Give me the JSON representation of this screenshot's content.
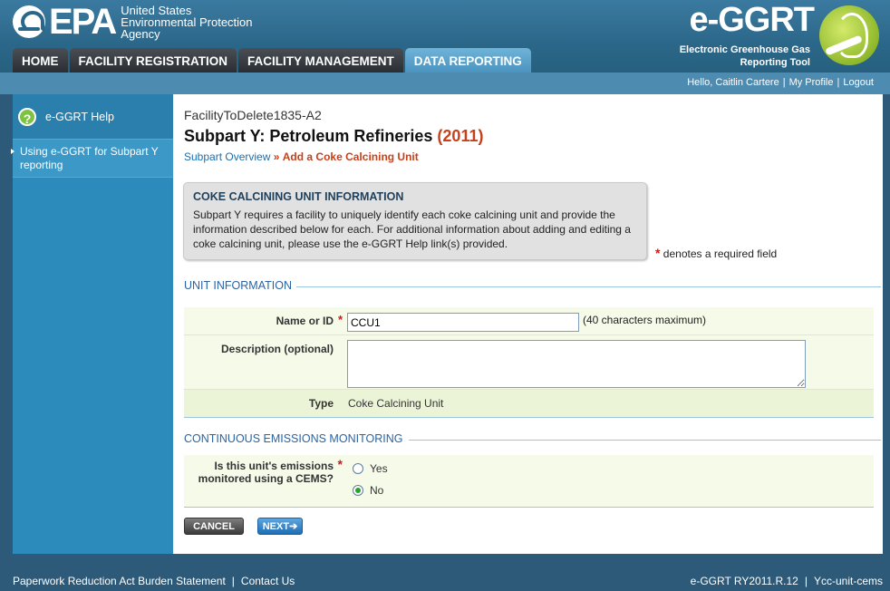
{
  "header": {
    "epa_letters": "EPA",
    "epa_agency_line1": "United States",
    "epa_agency_line2": "Environmental Protection",
    "epa_agency_line3": "Agency",
    "app_title": "e-GGRT",
    "app_subtitle_line1": "Electronic Greenhouse Gas",
    "app_subtitle_line2": "Reporting Tool"
  },
  "tabs": [
    {
      "label": "HOME"
    },
    {
      "label": "FACILITY REGISTRATION"
    },
    {
      "label": "FACILITY MANAGEMENT"
    },
    {
      "label": "DATA REPORTING",
      "active": true
    }
  ],
  "userbar": {
    "greeting": "Hello, Caitlin Cartere",
    "profile": "My Profile",
    "logout": "Logout"
  },
  "sidebar": {
    "help_label": "e-GGRT Help",
    "help_link": "Using e-GGRT for Subpart Y reporting"
  },
  "main": {
    "facility": "FacilityToDelete1835-A2",
    "title": "Subpart Y: Petroleum Refineries",
    "year": "(2011)",
    "breadcrumb_link": "Subpart Overview",
    "breadcrumb_sep": "»",
    "breadcrumb_current": "Add a Coke Calcining Unit",
    "info_title": "COKE CALCINING UNIT INFORMATION",
    "info_text": "Subpart Y requires a facility to uniquely identify each coke calcining unit and provide the information described below for each. For additional information about adding and editing a coke calcining unit, please use the e-GGRT Help link(s) provided.",
    "required_marker": "*",
    "required_note": "denotes a required field",
    "unit_section": "UNIT INFORMATION",
    "name_label": "Name or ID",
    "name_value": "CCU1",
    "name_max": "(40 characters maximum)",
    "desc_label": "Description (optional)",
    "desc_value": "",
    "type_label": "Type",
    "type_value": "Coke Calcining Unit",
    "cems_section": "CONTINUOUS EMISSIONS MONITORING",
    "cems_label_line1": "Is this unit's emissions",
    "cems_label_line2": "monitored using a CEMS?",
    "cems_yes": "Yes",
    "cems_no": "No",
    "cems_selected": "No",
    "cancel_label": "CANCEL",
    "next_label": "NEXT",
    "next_arrow": "➔"
  },
  "footer": {
    "paperwork": "Paperwork Reduction Act Burden Statement",
    "contact": "Contact Us",
    "version": "e-GGRT RY2011.R.12",
    "page_id": "Ycc-unit-cems"
  },
  "colors": {
    "header_blue": "#2b6789",
    "accent_orange": "#c8401a",
    "link_blue": "#1a6fb0",
    "sidebar_blue": "#2d8bbb",
    "active_tab": "#4a94c0"
  }
}
